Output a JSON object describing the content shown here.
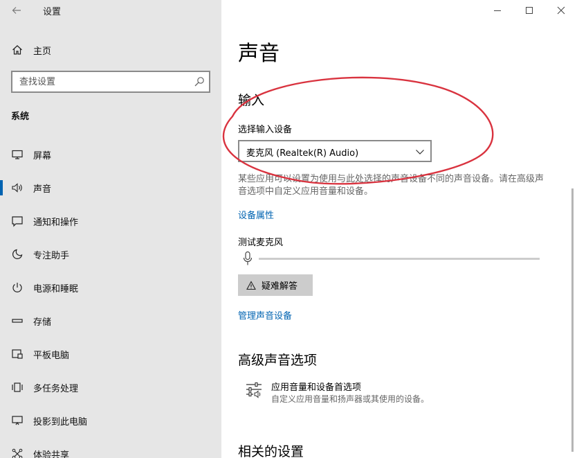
{
  "app": {
    "title": "设置"
  },
  "sidebar": {
    "home_label": "主页",
    "search_placeholder": "查找设置",
    "section": "系统",
    "items": [
      {
        "label": "屏幕",
        "icon": "display-icon"
      },
      {
        "label": "声音",
        "icon": "speaker-icon",
        "active": true
      },
      {
        "label": "通知和操作",
        "icon": "notification-icon"
      },
      {
        "label": "专注助手",
        "icon": "moon-icon"
      },
      {
        "label": "电源和睡眠",
        "icon": "power-icon"
      },
      {
        "label": "存储",
        "icon": "storage-icon"
      },
      {
        "label": "平板电脑",
        "icon": "tablet-icon"
      },
      {
        "label": "多任务处理",
        "icon": "multitask-icon"
      },
      {
        "label": "投影到此电脑",
        "icon": "project-icon"
      },
      {
        "label": "体验共享",
        "icon": "share-icon"
      }
    ]
  },
  "main": {
    "title": "声音",
    "input_heading": "输入",
    "select_label": "选择输入设备",
    "selected_device": "麦克风 (Realtek(R) Audio)",
    "description": "某些应用可以设置为使用与此处选择的声音设备不同的声音设备。请在高级声音选项中自定义应用音量和设备。",
    "device_properties_link": "设备属性",
    "test_mic_label": "测试麦克风",
    "mic_level": 0,
    "troubleshoot_label": "疑难解答",
    "manage_devices_link": "管理声音设备",
    "advanced_heading": "高级声音选项",
    "advanced_item_title": "应用音量和设备首选项",
    "advanced_item_subtitle": "自定义应用音量和扬声器或其使用的设备。",
    "related_heading": "相关的设置"
  },
  "colors": {
    "accent": "#0063b1",
    "sidebar_bg": "#e6e6e6",
    "annotation": "#d9333f"
  }
}
